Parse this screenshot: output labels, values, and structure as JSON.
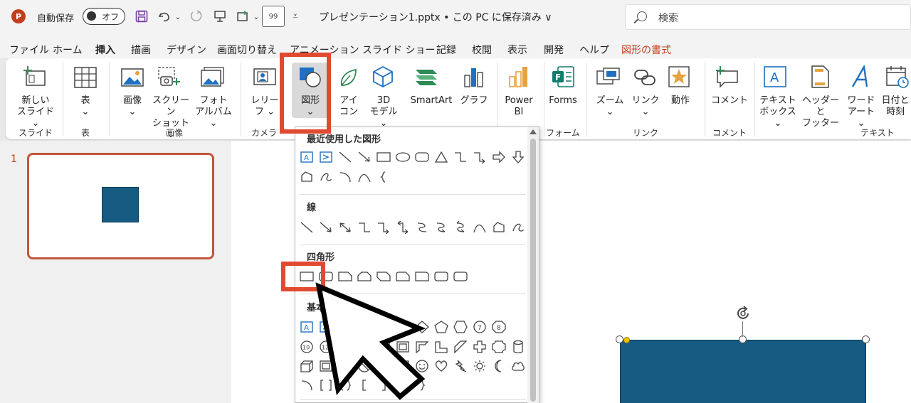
{
  "titlebar": {
    "app_logo": "P",
    "autosave_label": "自動保存",
    "autosave_state": "オフ",
    "qat_buffer": "99",
    "doc_title": "プレゼンテーション1.pptx • この PC に保存済み ∨",
    "search_placeholder": "検索"
  },
  "tabs": [
    {
      "label": "ファイル"
    },
    {
      "label": "ホーム"
    },
    {
      "label": "挿入"
    },
    {
      "label": "描画"
    },
    {
      "label": "デザイン"
    },
    {
      "label": "画面切り替え"
    },
    {
      "label": "アニメーション"
    },
    {
      "label": "スライド ショー"
    },
    {
      "label": "記録"
    },
    {
      "label": "校閲"
    },
    {
      "label": "表示"
    },
    {
      "label": "開発"
    },
    {
      "label": "ヘルプ"
    },
    {
      "label": "図形の書式"
    }
  ],
  "ribbon": {
    "buttons": {
      "new_slide": "新しい\nスライド ⌄",
      "table": "表\n⌄",
      "image": "画像\n⌄",
      "screenshot": "スクリーン\nショット ⌄",
      "photo_album": "フォト\nアルバム ⌄",
      "cameo": "レリー\nフ ⌄",
      "shapes": "図形\n⌄",
      "icons": "アイ\nコン",
      "model3d": "3D\nモデル ⌄",
      "smartart": "SmartArt",
      "chart": "グラフ",
      "powerbi": "Power\nBI",
      "forms": "Forms",
      "zoom": "ズーム\n⌄",
      "link": "リンク\n⌄",
      "action": "動作",
      "comment": "コメント",
      "textbox": "テキスト\nボックス ⌄",
      "header_footer": "ヘッダーと\nフッター",
      "wordart": "ワード\nアート ⌄",
      "datetime": "日付と\n時刻"
    },
    "groups": {
      "slides": "スライド",
      "tables": "表",
      "images": "画像",
      "camera": "カメラ",
      "forms": "フォーム",
      "links": "リンク",
      "comments": "コメント",
      "text": "テキスト"
    }
  },
  "slides_panel": {
    "slide_number": "1"
  },
  "shapes_menu": {
    "recent_title": "最近使用した図形",
    "lines_title": "線",
    "rect_title": "四角形",
    "basic_title": "基本"
  },
  "colors": {
    "accent": "#c43e1c",
    "shape_fill": "#155b82",
    "callout": "#e04a31"
  }
}
